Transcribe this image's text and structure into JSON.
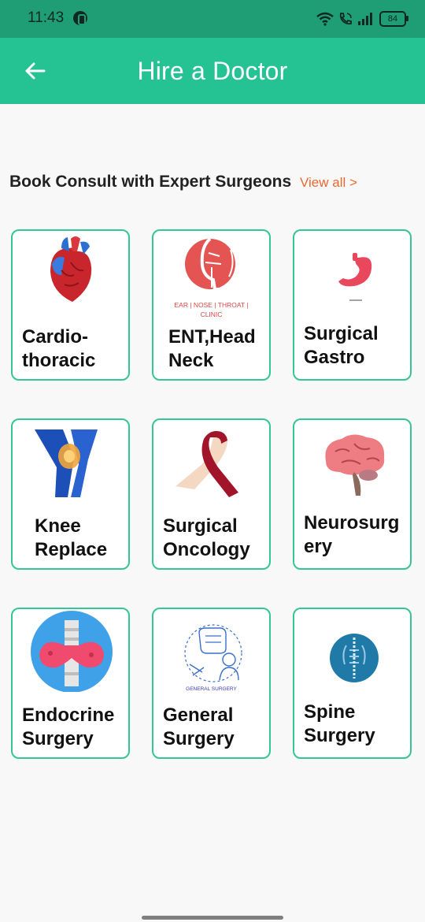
{
  "status": {
    "time": "11:43",
    "battery": "84"
  },
  "header": {
    "title": "Hire a Doctor"
  },
  "section": {
    "title": "Book Consult with Expert Surgeons",
    "view_all": "View all >"
  },
  "cards": [
    {
      "label": "Cardio-\nthoracic",
      "icon": "heart-icon"
    },
    {
      "label": "ENT,Head\nNeck",
      "icon": "ent-icon",
      "caption": "EAR | NOSE | THROAT |\nCLINIC"
    },
    {
      "label": "Surgical\nGastro",
      "icon": "stomach-icon"
    },
    {
      "label": "Knee\nReplace",
      "icon": "knee-icon"
    },
    {
      "label": "Surgical\nOncology",
      "icon": "ribbon-icon"
    },
    {
      "label": "Neurosurg\nery",
      "icon": "brain-icon"
    },
    {
      "label": "Endocrine\nSurgery",
      "icon": "thyroid-icon"
    },
    {
      "label": "General\nSurgery",
      "icon": "general-surgery-icon",
      "caption": "GENERAL SURGERY"
    },
    {
      "label": "Spine\nSurgery",
      "icon": "spine-icon"
    }
  ],
  "colors": {
    "appbar": "#25c294",
    "statusbar": "#1f9e76",
    "card_border": "#36c597",
    "link": "#e8692f"
  }
}
